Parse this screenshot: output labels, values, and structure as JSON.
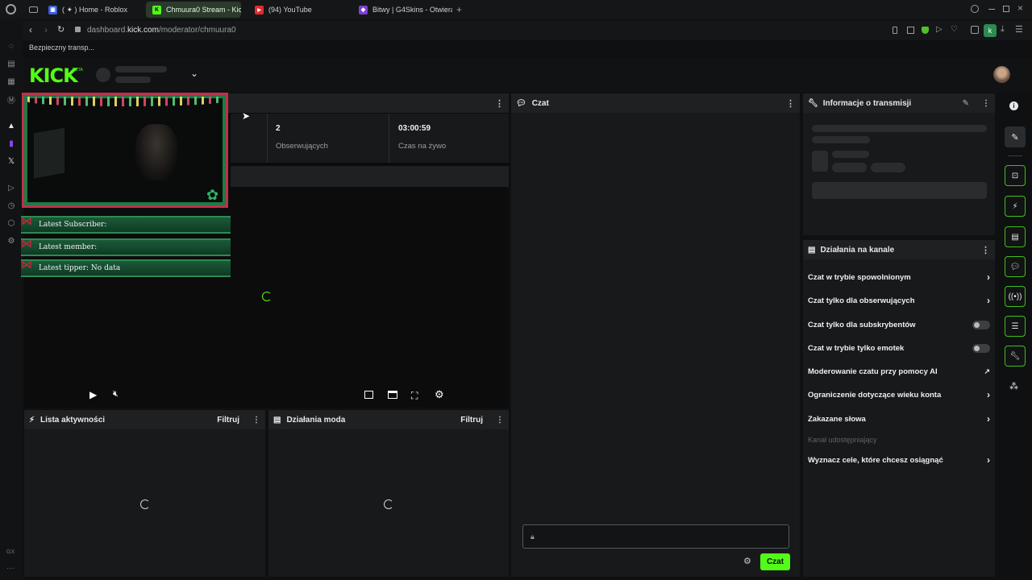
{
  "browser": {
    "tabs": [
      {
        "label": "( ✦ ) Home - Roblox",
        "icon": "roblox-icon",
        "active": false
      },
      {
        "label": "Chmuura0 Stream - Kick",
        "icon": "kick-icon",
        "active": true
      },
      {
        "label": "(94) YouTube",
        "icon": "youtube-icon",
        "active": false
      },
      {
        "label": "Bitwy | G4Skins - Otwiera",
        "icon": "g4skins-icon",
        "active": false
      }
    ],
    "url_prefix": "dashboard.",
    "url_domain": "kick.com",
    "url_path": "/moderator/chmuura0",
    "security_note": "Bezpieczny transp...",
    "profile_letter": "k"
  },
  "kick": {
    "logo": "KICK",
    "beta": "BETA"
  },
  "stats": {
    "followers_value": "2",
    "followers_label": "Obserwujących",
    "live_time_value": "03:00:59",
    "live_time_label": "Czas na żywo"
  },
  "overlay": {
    "latest_subscriber": "Latest Subscriber:",
    "latest_member": "Latest member:",
    "latest_tipper": "Latest tipper: No data"
  },
  "activity": {
    "title": "Lista aktywności",
    "filter": "Filtruj"
  },
  "mod_actions": {
    "title": "Działania moda",
    "filter": "Filtruj"
  },
  "chat": {
    "title": "Czat",
    "send_label": "Czat",
    "accent": "#53fc18"
  },
  "stream_info": {
    "title": "Informacje o transmisji"
  },
  "channel_actions": {
    "title": "Działania na kanale",
    "items": [
      {
        "label": "Czat w trybie spowolnionym",
        "control": "chevron"
      },
      {
        "label": "Czat tylko dla obserwujących",
        "control": "chevron"
      },
      {
        "label": "Czat tylko dla subskrybentów",
        "control": "toggle"
      },
      {
        "label": "Czat w trybie tylko emotek",
        "control": "toggle"
      },
      {
        "label": "Moderowanie czatu przy pomocy AI",
        "control": "external"
      },
      {
        "label": "Ograniczenie dotyczące wieku konta",
        "control": "chevron"
      },
      {
        "label": "Zakazane słowa",
        "control": "chevron"
      }
    ],
    "section_label": "Kanał udostępniający",
    "goals": "Wyznacz cele, które chcesz osiągnąć"
  },
  "os": {
    "bottom_left": "GX"
  }
}
